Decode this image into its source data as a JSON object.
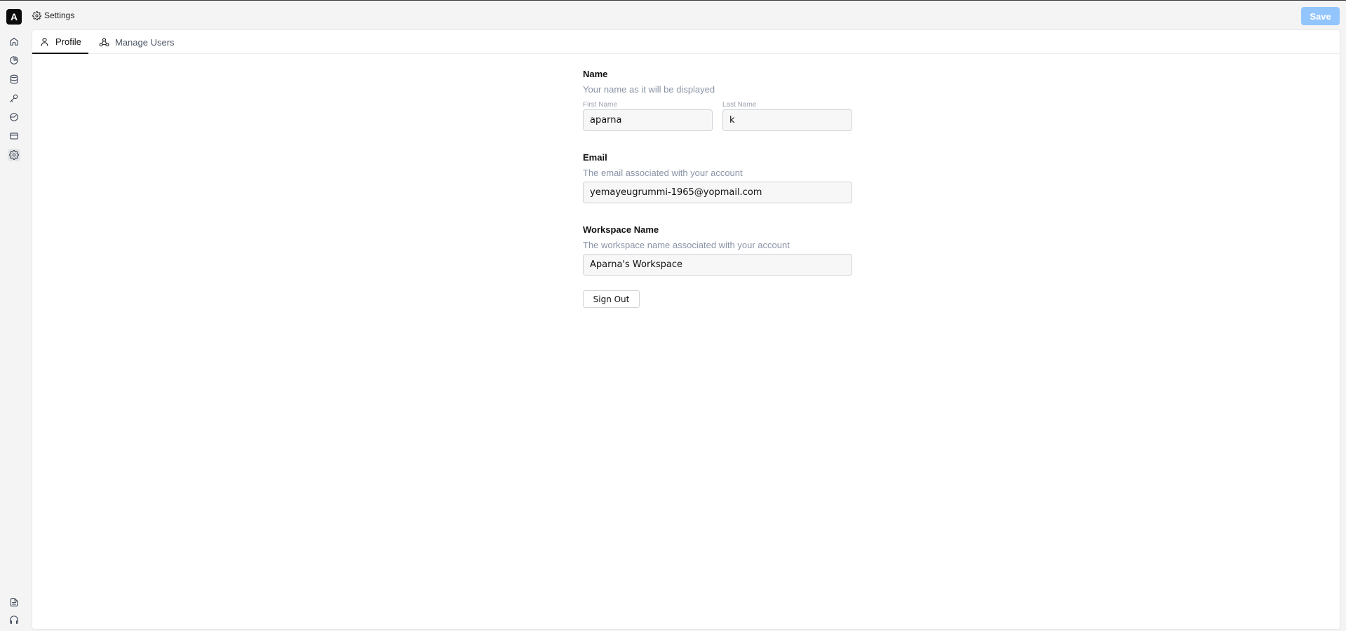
{
  "app": {
    "logo_letter": "A",
    "page_title": "Settings",
    "save_label": "Save",
    "accent_color": "#93c5fd"
  },
  "rail": {
    "top_icons": [
      "home-icon",
      "pie-chart-icon",
      "database-icon",
      "key-icon",
      "dashboard-icon",
      "card-icon",
      "gear-icon"
    ],
    "active_icon": "gear-icon",
    "bottom_icons": [
      "document-icon",
      "headset-icon"
    ]
  },
  "tabs": [
    {
      "label": "Profile",
      "icon": "user-icon",
      "active": true
    },
    {
      "label": "Manage Users",
      "icon": "users-icon",
      "active": false
    }
  ],
  "profile": {
    "name_title": "Name",
    "name_desc": "Your name as it will be displayed",
    "first_name_label": "First Name",
    "first_name_value": "aparna",
    "last_name_label": "Last Name",
    "last_name_value": "k",
    "email_title": "Email",
    "email_desc": "The email associated with your account",
    "email_value": "yemayeugrummi-1965@yopmail.com",
    "workspace_title": "Workspace Name",
    "workspace_desc": "The workspace name associated with your account",
    "workspace_value": "Aparna's Workspace",
    "sign_out_label": "Sign Out"
  }
}
